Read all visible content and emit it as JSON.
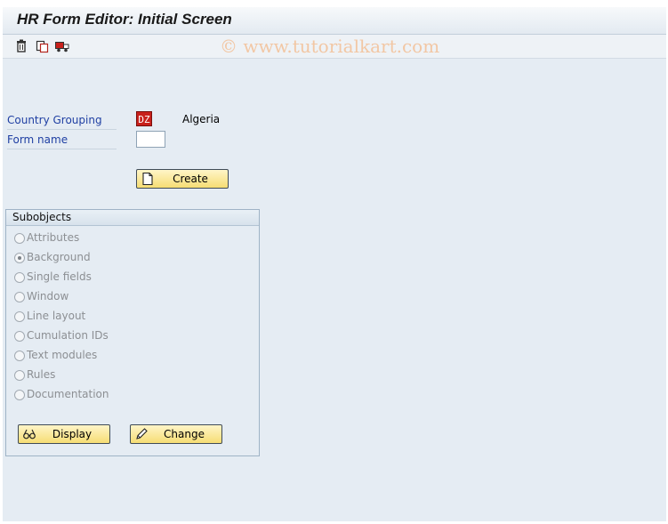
{
  "window": {
    "title": "HR Form Editor: Initial Screen"
  },
  "toolbar": {
    "icons": [
      "delete-icon",
      "copy-icon",
      "transport-icon"
    ]
  },
  "watermark": "© www.tutorialkart.com",
  "form": {
    "country_grouping_label": "Country Grouping",
    "country_grouping_value": "DZ",
    "country_grouping_text": "Algeria",
    "form_name_label": "Form name",
    "form_name_value": "",
    "create_label": "Create"
  },
  "subobjects": {
    "title": "Subobjects",
    "options": [
      {
        "label": "Attributes",
        "selected": false
      },
      {
        "label": "Background",
        "selected": true
      },
      {
        "label": "Single fields",
        "selected": false
      },
      {
        "label": "Window",
        "selected": false
      },
      {
        "label": "Line layout",
        "selected": false
      },
      {
        "label": "Cumulation IDs",
        "selected": false
      },
      {
        "label": "Text modules",
        "selected": false
      },
      {
        "label": "Rules",
        "selected": false
      },
      {
        "label": "Documentation",
        "selected": false
      }
    ],
    "display_label": "Display",
    "change_label": "Change"
  },
  "colors": {
    "label_blue": "#1f3fa3",
    "button_yellow": "#f6dd74",
    "required_red": "#c8201b",
    "background": "#e5ecf3"
  }
}
